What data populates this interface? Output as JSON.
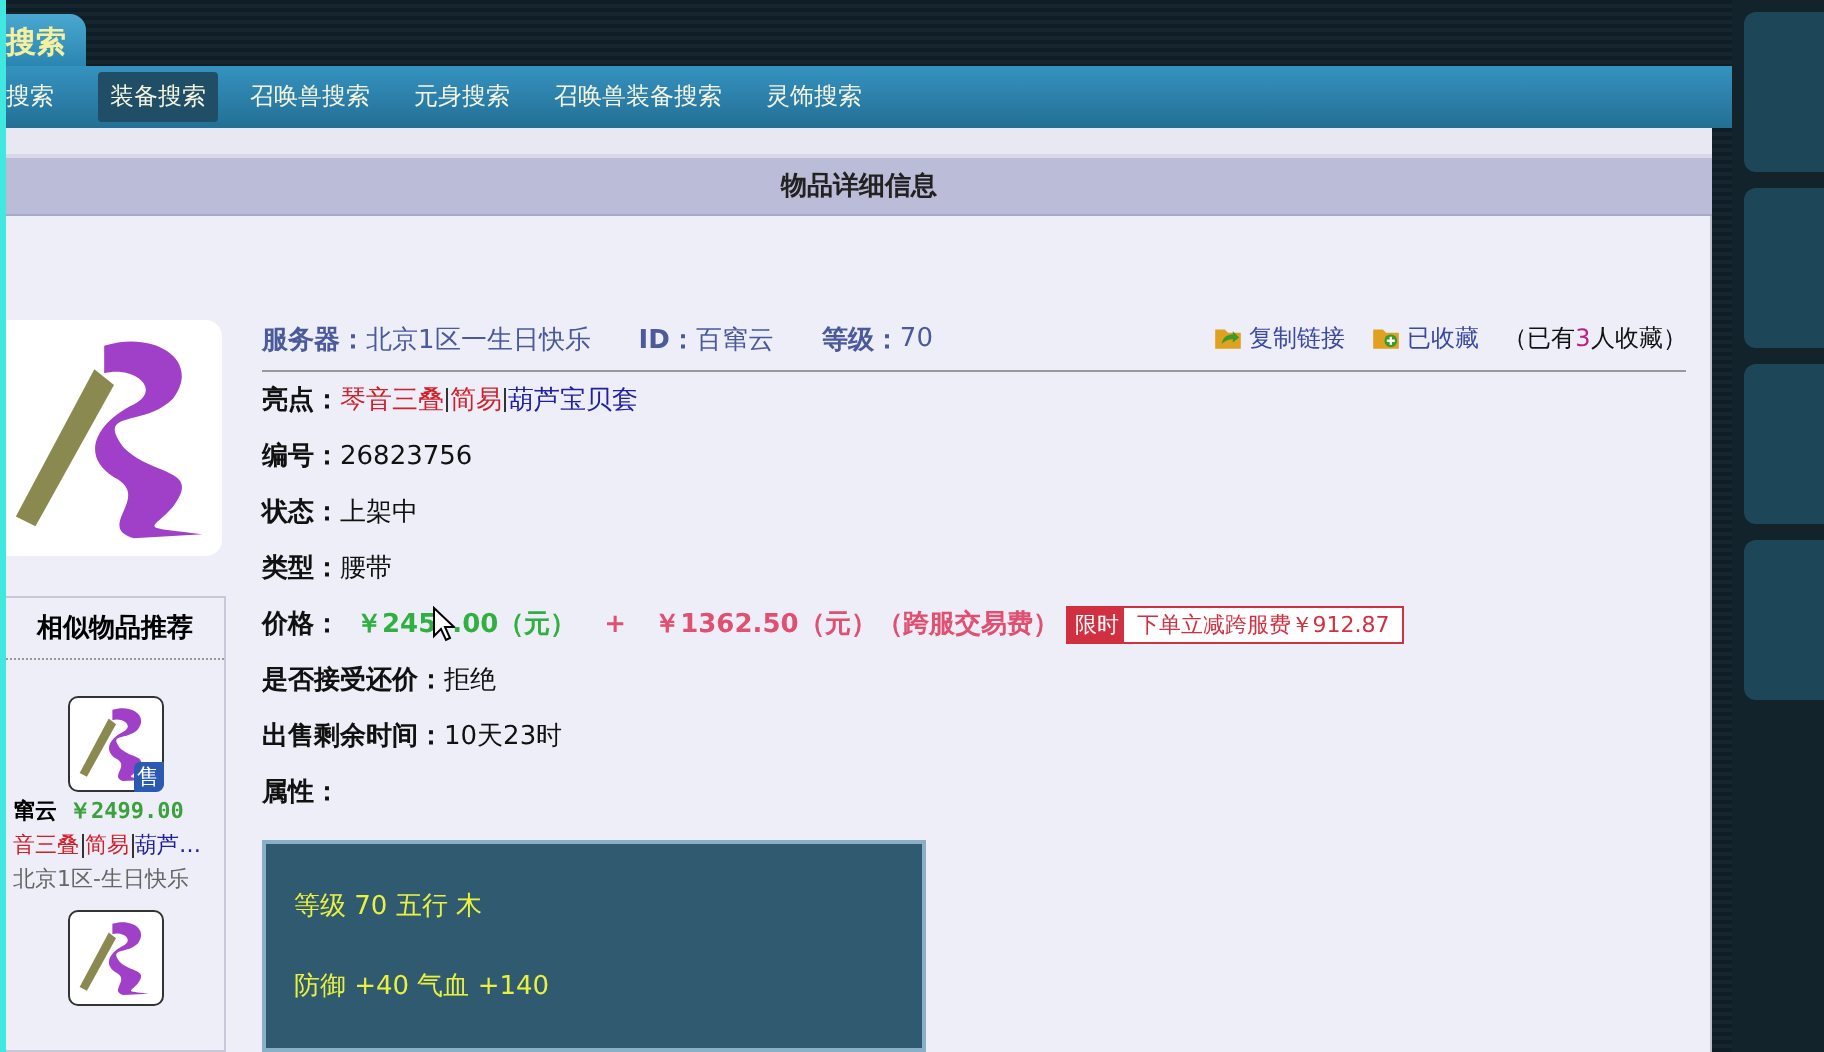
{
  "top_tab": {
    "label": "搜索"
  },
  "nav": [
    {
      "label": "搜索",
      "selected": false
    },
    {
      "label": "装备搜索",
      "selected": true
    },
    {
      "label": "召唤兽搜索",
      "selected": false
    },
    {
      "label": "元身搜索",
      "selected": false
    },
    {
      "label": "召唤兽装备搜索",
      "selected": false
    },
    {
      "label": "灵饰搜索",
      "selected": false
    }
  ],
  "panel_title": "物品详细信息",
  "info": [
    {
      "label": "服务器：",
      "value": "北京1区一生日快乐"
    },
    {
      "label": "ID：",
      "value": "百窜云"
    },
    {
      "label": "等级：",
      "value": "70"
    }
  ],
  "actions": [
    {
      "kind": "share",
      "label": "复制链接"
    },
    {
      "kind": "favorite",
      "label": "已收藏"
    }
  ],
  "favorites": {
    "prefix": "（已有",
    "count": "3",
    "suffix": "人收藏）"
  },
  "details": [
    {
      "kind": "tags",
      "label": "亮点：",
      "tags": [
        {
          "text": "琴音三叠",
          "color": "#d0202a"
        },
        {
          "text": "简易",
          "color": "#d0202a"
        },
        {
          "text": "葫芦宝贝套",
          "color": "#2020a0"
        }
      ]
    },
    {
      "kind": "text",
      "label": "编号：",
      "value": "26823756"
    },
    {
      "kind": "text",
      "label": "状态：",
      "value": "上架中"
    },
    {
      "kind": "text",
      "label": "类型：",
      "value": "腰带"
    },
    {
      "kind": "price",
      "label": "价格：",
      "price_start": "￥245",
      "price_end": ".00（元）",
      "plus": "+",
      "fee": "￥1362.50（元）（跨服交易费）",
      "promo_tag": "限时",
      "promo_text": "下单立减跨服费￥912.87"
    },
    {
      "kind": "text",
      "label": "是否接受还价：",
      "value": "拒绝"
    },
    {
      "kind": "text",
      "label": "出售剩余时间：",
      "value": "10天23时"
    },
    {
      "kind": "text",
      "label": "属性："
    }
  ],
  "attributes": [
    "等级 70 五行 木",
    "防御 +40 气血 +140"
  ],
  "similar": {
    "title": "相似物品推荐",
    "items": [
      {
        "badge": "售",
        "seller": "窜云",
        "price": "￥2499.00",
        "tags": [
          {
            "text": "音三叠",
            "color": "#d0202a"
          },
          {
            "text": "简易",
            "color": "#d0202a"
          },
          {
            "text": "葫芦…",
            "color": "#2020a0"
          }
        ],
        "server": "北京1区-生日快乐"
      }
    ]
  }
}
